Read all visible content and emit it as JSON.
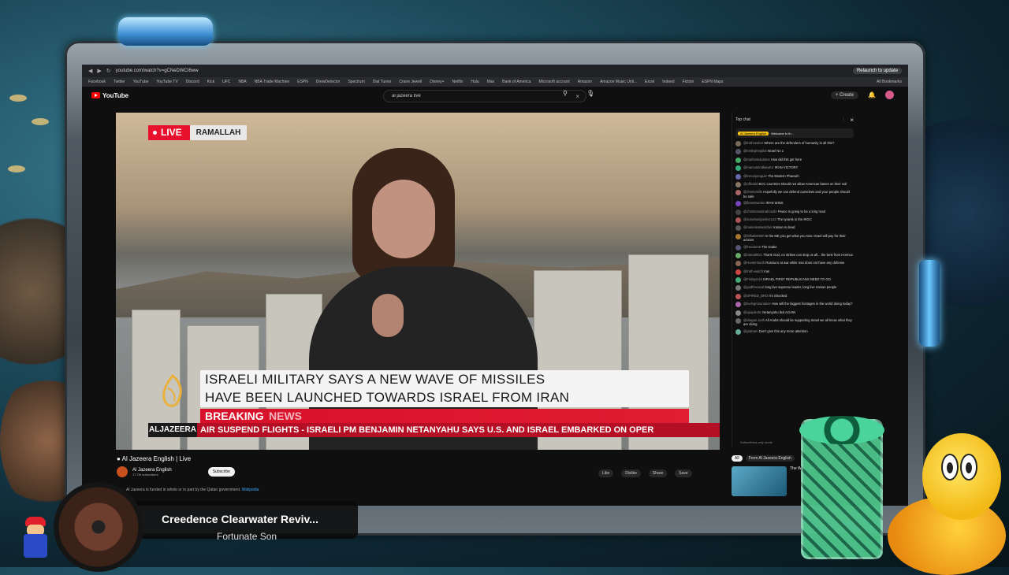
{
  "browser": {
    "url": "youtube.com/watch?v=gCNeDWCI6ww",
    "relaunch_label": "Relaunch to update",
    "bookmarks": [
      "Facebook",
      "Twitter",
      "YouTube",
      "YouTube TV",
      "Discord",
      "Kick",
      "UFC",
      "NBA",
      "NBA Trade Machine",
      "ESPN",
      "DrewDetector",
      "Spectrum",
      "Dial Tunes",
      "Crane Jewell",
      "Disney+",
      "Netflix",
      "Hulu",
      "Max",
      "Bank of America",
      "Microsoft account",
      "Amazon",
      "Amazon Music Unli...",
      "Excel",
      "Indeed",
      "Fiction",
      "ESPN Maps"
    ],
    "all_bookmarks": "All Bookmarks"
  },
  "youtube": {
    "logo_text": "YouTube",
    "search_value": "al jazeera live",
    "create_label": "Create"
  },
  "video": {
    "live_label": "LIVE",
    "location": "RAMALLAH",
    "headline_line1": "ISRAELI MILITARY SAYS A NEW WAVE OF MISSILES",
    "headline_line2": "HAVE BEEN LAUNCHED TOWARDS ISRAEL FROM IRAN",
    "breaking": "BREAKING",
    "news": "NEWS",
    "ticker_brand": "ALJAZEERA",
    "ticker_text": "AIR SUSPEND FLIGHTS   -   ISRAELI PM BENJAMIN NETANYAHU SAYS U.S. AND ISRAEL EMBARKED ON OPER",
    "title": "Al Jazeera English | Live",
    "channel": "Al Jazeera English",
    "subscribers": "17.7M subscribers",
    "subscribe_label": "Subscribe",
    "actions": [
      "Like",
      "Dislike",
      "Share",
      "Save"
    ],
    "info_text": "Al Jazeera is funded in whole or in part by the Qatari government.",
    "info_link": "Wikipedia"
  },
  "chat": {
    "header": "Top chat",
    "pinned_channel": "Al Jazeera English",
    "pinned_text": "Welcome to th...",
    "messages": [
      {
        "user": "@truthseeker",
        "text": "Where are the defenders of humanity in all this?",
        "color": "#7a6a5a"
      },
      {
        "user": "@mrskylinepilot",
        "text": "Israel No 1",
        "color": "#556"
      },
      {
        "user": "@marlonsolutions",
        "text": "How did this get here",
        "color": "#4a6"
      },
      {
        "user": "@marcusrindkiewicz",
        "text": "IRAN VICTORY",
        "color": "#3a7"
      },
      {
        "user": "@trevorpenguin",
        "text": "The Modern Pharaoh",
        "color": "#66a"
      },
      {
        "user": "@officiald",
        "text": "BCC countries should not allow American bases on their soil",
        "color": "#876"
      },
      {
        "user": "@cheriemills",
        "text": "Hopefully we can defend ourselves and your people should be safe",
        "color": "#a66"
      },
      {
        "user": "@fitnessworks",
        "text": "IRAN WINS",
        "color": "#74b"
      },
      {
        "user": "@christomasinahoodie",
        "text": "Peace is going to be a long road",
        "color": "#444"
      },
      {
        "user": "@somebodyonline123",
        "text": "The tyrants in the IRGC",
        "color": "#a55"
      },
      {
        "user": "@namelesswatcher",
        "text": "Iranian is dead",
        "color": "#555"
      },
      {
        "user": "@Mihalis9930",
        "text": "In the ME you get what you sow. Israel will pay for their actions",
        "color": "#a73"
      },
      {
        "user": "@freedom8",
        "text": "The snake",
        "color": "#557"
      },
      {
        "user": "@ntorai9021",
        "text": "Thank God, no strikes can stop us all... the best from Hormuz",
        "color": "#6a6"
      },
      {
        "user": "@HunterNorth",
        "text": "Russia is at war while Iran does not have any defense",
        "color": "#865"
      },
      {
        "user": "@truth-watch",
        "text": "Iran",
        "color": "#c44"
      },
      {
        "user": "@Fridayrock",
        "text": "ISRAEL FIRST REPUBLICANS NEED TO GO",
        "color": "#4a7"
      },
      {
        "user": "@godfreeseat",
        "text": "long live supreme leader, long live Iranian people",
        "color": "#777"
      },
      {
        "user": "@SPIRED_BRO",
        "text": "I'm Shocked",
        "color": "#b55"
      },
      {
        "user": "@lovingmountains",
        "text": "How will the biggest hostages in the world doing today?",
        "color": "#a6a"
      },
      {
        "user": "@apoplectic",
        "text": "Netanyahu lied AGAIN",
        "color": "#888"
      },
      {
        "user": "@dragon.sixth",
        "text": "All Arabs should be supporting Israel we all know what they are doing",
        "color": "#666"
      },
      {
        "user": "@graham",
        "text": "Don't give this any more attention",
        "color": "#6a9"
      }
    ],
    "footer": "Subscribers-only mode"
  },
  "recs": {
    "chips": [
      "All",
      "From Al Jazeera English"
    ],
    "title": "The Wor... Netanya..."
  },
  "now_playing": {
    "artist": "Creedence Clearwater Reviv...",
    "song": "Fortunate Son"
  }
}
